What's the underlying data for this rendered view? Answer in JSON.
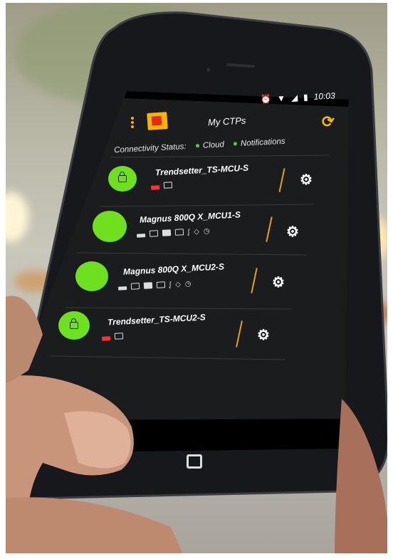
{
  "status_bar": {
    "time": "10:03",
    "icons": [
      "alarm-icon",
      "wifi-icon",
      "signal-icon",
      "battery-icon"
    ]
  },
  "app_bar": {
    "title": "My CTPs",
    "menu_icon": "kebab-menu-icon",
    "logo": "kodak-logo",
    "refresh_icon": "sync-icon"
  },
  "connectivity": {
    "label": "Connectivity Status:",
    "items": [
      {
        "label": "Cloud",
        "color": "#4cd137"
      },
      {
        "label": "Notifications",
        "color": "#4cd137"
      }
    ]
  },
  "devices": [
    {
      "name": "Trendsetter_TS-MCU-S",
      "status_color": "#6ee01f",
      "locked": true,
      "icons": [
        "lock-icon",
        "tray-icon"
      ]
    },
    {
      "name": "Magnus 800Q X_MCU1-S",
      "status_color": "#6ee01f",
      "locked": false,
      "icons": [
        "lock-icon",
        "tray-icon",
        "cassette-icon",
        "media-icon",
        "thermometer-icon",
        "drop-icon",
        "clock-icon"
      ]
    },
    {
      "name": "Magnus 800Q X_MCU2-S",
      "status_color": "#6ee01f",
      "locked": false,
      "icons": [
        "lock-icon",
        "tray-icon",
        "cassette-icon",
        "media-icon",
        "thermometer-icon",
        "drop-icon",
        "clock-icon"
      ]
    },
    {
      "name": "Trendsetter_TS-MCU2-S",
      "status_color": "#6ee01f",
      "locked": true,
      "icons": [
        "lock-icon",
        "tray-icon"
      ]
    }
  ],
  "accent_color": "#f2b417",
  "alert_color": "#ff3030"
}
